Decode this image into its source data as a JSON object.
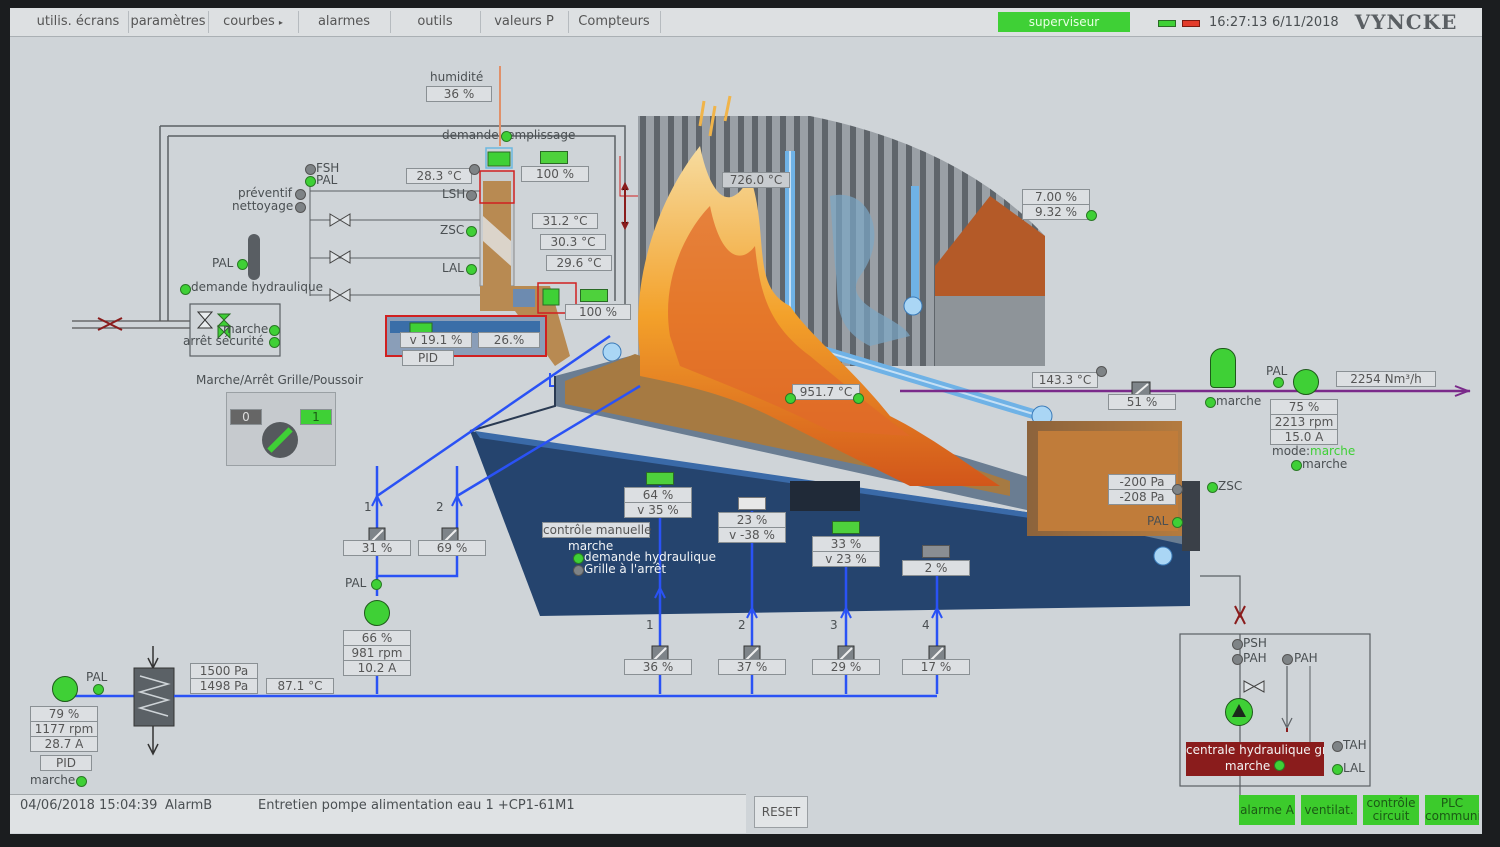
{
  "menu": [
    "utilis. écrans",
    "paramètres",
    "courbes",
    "alarmes",
    "outils",
    "valeurs P",
    "Compteurs"
  ],
  "menu_arrow": "▸",
  "header": {
    "user": "superviseur",
    "time": "16:27:13",
    "date": "6/11/2018",
    "brand": "VYNCKE"
  },
  "feed": {
    "humidite_label": "humidité",
    "humidite_value": "36 %",
    "demande_label": "demande remplissage",
    "fsh": "FSH",
    "pal": "PAL",
    "preventif": "préventif",
    "nettoyage": "nettoyage",
    "lsh": "LSH",
    "zsc": "ZSC",
    "lal": "LAL",
    "pal2": "PAL",
    "demande_hydraulique": "demande hydraulique",
    "marche": "marche",
    "arret_securite": "arrêt sécurité",
    "temp1": "28.3 °C",
    "fill1": "100 %",
    "t2": "31.2 °C",
    "t3": "30.3 °C",
    "t4": "29.6 °C",
    "fill2": "100 %",
    "v_speed": "v 19.1 %",
    "pct": "26.%",
    "pid": "PID"
  },
  "grille": {
    "title": "Marche/Arrêt  Grille/Poussoir",
    "off": "0",
    "on": "1"
  },
  "furnace": {
    "temp_top": "726.0 °C",
    "temp_grate": "951.7 °C",
    "o2_1": "7.00 %",
    "o2_2": "9.32 %",
    "flue_temp": "143.3 °C",
    "damper": "51 %",
    "marche": "marche",
    "pal": "PAL",
    "flow": "2254 Nm³/h",
    "fan_pct": "75 %",
    "fan_rpm": "2213 rpm",
    "fan_amp": "15.0 A",
    "mode_label": "mode:",
    "mode_value": "marche",
    "marche2": "marche",
    "press1": "-200 Pa",
    "press2": "-208 Pa",
    "zsc": "ZSC",
    "pal2": "PAL"
  },
  "zones": {
    "z1_pct": "64 %",
    "z1_v": "v 35 %",
    "z2_pct": "23 %",
    "z2_v": "v -38 %",
    "z3_pct": "33 %",
    "z3_v": "v 23 %",
    "z4_pct": "2 %",
    "manual": "contrôle manuelle",
    "marche": "marche",
    "demande_hydraulique": "demande hydraulique",
    "grille_arret": "Grille à l'arrêt"
  },
  "air": {
    "d1_label": "1",
    "d1": "31 %",
    "d2_label": "2",
    "d2": "69 %",
    "pal": "PAL",
    "pump_pct": "66 %",
    "pump_rpm": "981 rpm",
    "pump_amp": "10.2 A",
    "u1": "1",
    "u1v": "36 %",
    "u2": "2",
    "u2v": "37 %",
    "u3": "3",
    "u3v": "29 %",
    "u4": "4",
    "u4v": "17 %"
  },
  "water": {
    "pal": "PAL",
    "p1": "1500 Pa",
    "p2": "1498 Pa",
    "temp": "87.1 °C",
    "pct": "79 %",
    "rpm": "1177 rpm",
    "amp": "28.7 A",
    "pid": "PID",
    "marche": "marche"
  },
  "hydraulic": {
    "psh": "PSH",
    "pah": "PAH",
    "pah2": "PAH",
    "tah": "TAH",
    "lal": "LAL",
    "title": "centrale hydraulique gri",
    "marche": "marche"
  },
  "footer": {
    "alarm_time": "04/06/2018 15:04:39",
    "alarm_type": "AlarmB",
    "alarm_msg": "Entretien pompe alimentation eau 1 +CP1-61M1",
    "reset": "RESET",
    "btn1": "alarme A",
    "btn2": "ventilat.",
    "btn3": "contrôle circuit",
    "btn4": "PLC communicati"
  },
  "colors": {
    "accent_green": "#3fd036",
    "line_blue": "#2a52f5",
    "boiler_blue": "#25446e",
    "hydraulic_red": "#8a1c1c"
  }
}
